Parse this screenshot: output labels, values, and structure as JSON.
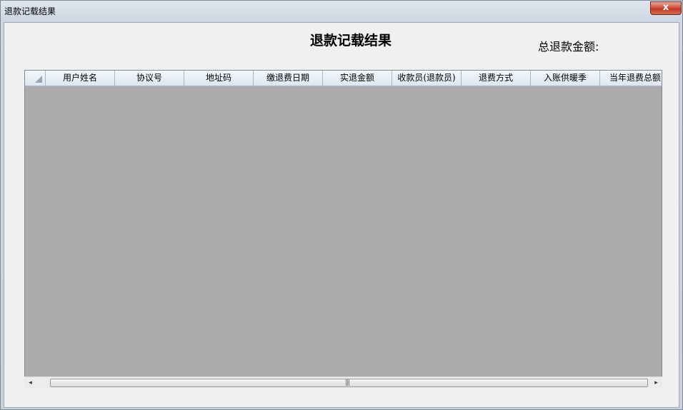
{
  "window": {
    "title": "退款记载结果",
    "close_label": "x"
  },
  "form": {
    "heading": "退款记载结果",
    "total_label": "总退款金额:"
  },
  "grid": {
    "columns": [
      "用户姓名",
      "协议号",
      "地址码",
      "缴退费日期",
      "实退金额",
      "收款员(退款员)",
      "退费方式",
      "入账供暖季",
      "当年退费总额"
    ],
    "rows": []
  },
  "scrollbar": {
    "left_arrow": "◂",
    "right_arrow": "▸",
    "grip": "|||"
  }
}
